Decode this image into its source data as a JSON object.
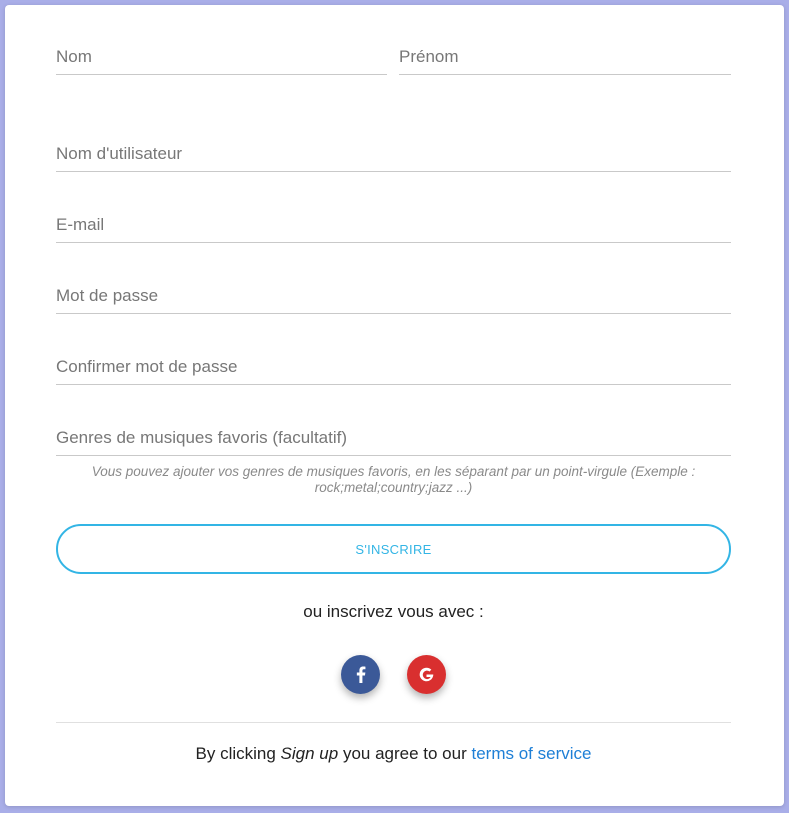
{
  "form": {
    "last_name_placeholder": "Nom",
    "first_name_placeholder": "Prénom",
    "username_placeholder": "Nom d'utilisateur",
    "email_placeholder": "E-mail",
    "password_placeholder": "Mot de passe",
    "confirm_password_placeholder": "Confirmer mot de passe",
    "genres_placeholder": "Genres de musiques favoris (facultatif)",
    "genres_hint": "Vous pouvez ajouter vos genres de musiques favoris, en les séparant par un point-virgule (Exemple : rock;metal;country;jazz ...)",
    "signup_label": "S'INSCRIRE"
  },
  "social": {
    "prompt": "ou inscrivez vous avec :",
    "facebook_icon": "facebook-icon",
    "google_icon": "google-icon",
    "facebook_color": "#3b5998",
    "google_color": "#d92f2f"
  },
  "footer": {
    "prefix": "By clicking ",
    "emphasis": "Sign up",
    "middle": " you agree to our ",
    "link_text": "terms of service"
  },
  "colors": {
    "accent": "#33b5e5",
    "link": "#1e7fd6",
    "background": "#a9aee8"
  }
}
